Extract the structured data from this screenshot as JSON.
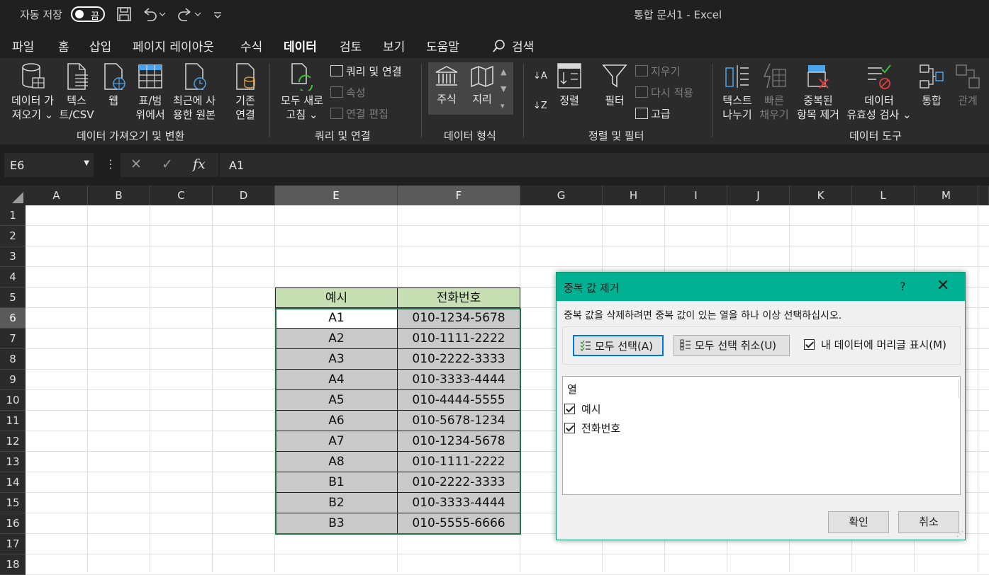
{
  "titlebar": {
    "autosave_label": "자동 저장",
    "autosave_state": "끔",
    "doc_title": "통합 문서1  -  Excel"
  },
  "tabs": [
    "파일",
    "홈",
    "삽입",
    "페이지 레이아웃",
    "수식",
    "데이터",
    "검토",
    "보기",
    "도움말"
  ],
  "active_tab": "데이터",
  "search_label": "검색",
  "ribbon": {
    "get_data": [
      "데이터 가",
      "져오기 ⌄"
    ],
    "text_csv": [
      "텍스",
      "트/CSV"
    ],
    "web": [
      "웹"
    ],
    "table_range": [
      "표/범",
      "위에서"
    ],
    "recent_sources": [
      "최근에 사",
      "용한 원본"
    ],
    "existing_conn": [
      "기존",
      "연결"
    ],
    "group_get_transform": "데이터 가져오기 및 변환",
    "refresh_all": [
      "모두 새로",
      "고침 ⌄"
    ],
    "queries_conn": "쿼리 및 연결",
    "properties": "속성",
    "edit_links": "연결 편집",
    "group_queries": "쿼리 및 연결",
    "stocks": "주식",
    "geography": "지리",
    "group_data_types": "데이터 형식",
    "sort": "정렬",
    "filter": "필터",
    "clear": "지우기",
    "reapply": "다시 적용",
    "advanced": "고급",
    "group_sort_filter": "정렬 및 필터",
    "text_to_columns": [
      "텍스트",
      "나누기"
    ],
    "flash_fill": [
      "빠른",
      "채우기"
    ],
    "remove_duplicates": [
      "중복된",
      "항목 제거"
    ],
    "data_validation": [
      "데이터",
      "유효성 검사 ⌄"
    ],
    "consolidate": "통합",
    "relationships": "관계",
    "group_data_tools": "데이터 도구"
  },
  "formula_bar": {
    "name_box": "E6",
    "fx": "fx",
    "formula": "A1"
  },
  "columns": [
    "A",
    "B",
    "C",
    "D",
    "E",
    "F",
    "G",
    "H",
    "I",
    "J",
    "K",
    "L",
    "M"
  ],
  "rows": [
    "1",
    "2",
    "3",
    "4",
    "5",
    "6",
    "7",
    "8",
    "9",
    "10",
    "11",
    "12",
    "13",
    "14",
    "15",
    "16",
    "17",
    "18"
  ],
  "table": {
    "headers": [
      "예시",
      "전화번호"
    ],
    "rows": [
      [
        "A1",
        "010-1234-5678"
      ],
      [
        "A2",
        "010-1111-2222"
      ],
      [
        "A3",
        "010-2222-3333"
      ],
      [
        "A4",
        "010-3333-4444"
      ],
      [
        "A5",
        "010-4444-5555"
      ],
      [
        "A6",
        "010-5678-1234"
      ],
      [
        "A7",
        "010-1234-5678"
      ],
      [
        "A8",
        "010-1111-2222"
      ],
      [
        "B1",
        "010-2222-3333"
      ],
      [
        "B2",
        "010-3333-4444"
      ],
      [
        "B3",
        "010-5555-6666"
      ]
    ]
  },
  "dialog": {
    "title": "중복 값 제거",
    "help": "?",
    "close": "✕",
    "instruction": "중복 값을 삭제하려면 중복 값이 있는 열을 하나 이상 선택하십시오.",
    "select_all": "모두 선택(A)",
    "unselect_all": "모두 선택 취소(U)",
    "has_headers": "내 데이터에 머리글 표시(M)",
    "list_header": "열",
    "columns": [
      "예시",
      "전화번호"
    ],
    "ok": "확인",
    "cancel": "취소"
  },
  "colors": {
    "accent": "#00b293",
    "header_fill": "#c6e0b4",
    "cell_fill": "#c9c9c9",
    "selection": "#217346"
  }
}
